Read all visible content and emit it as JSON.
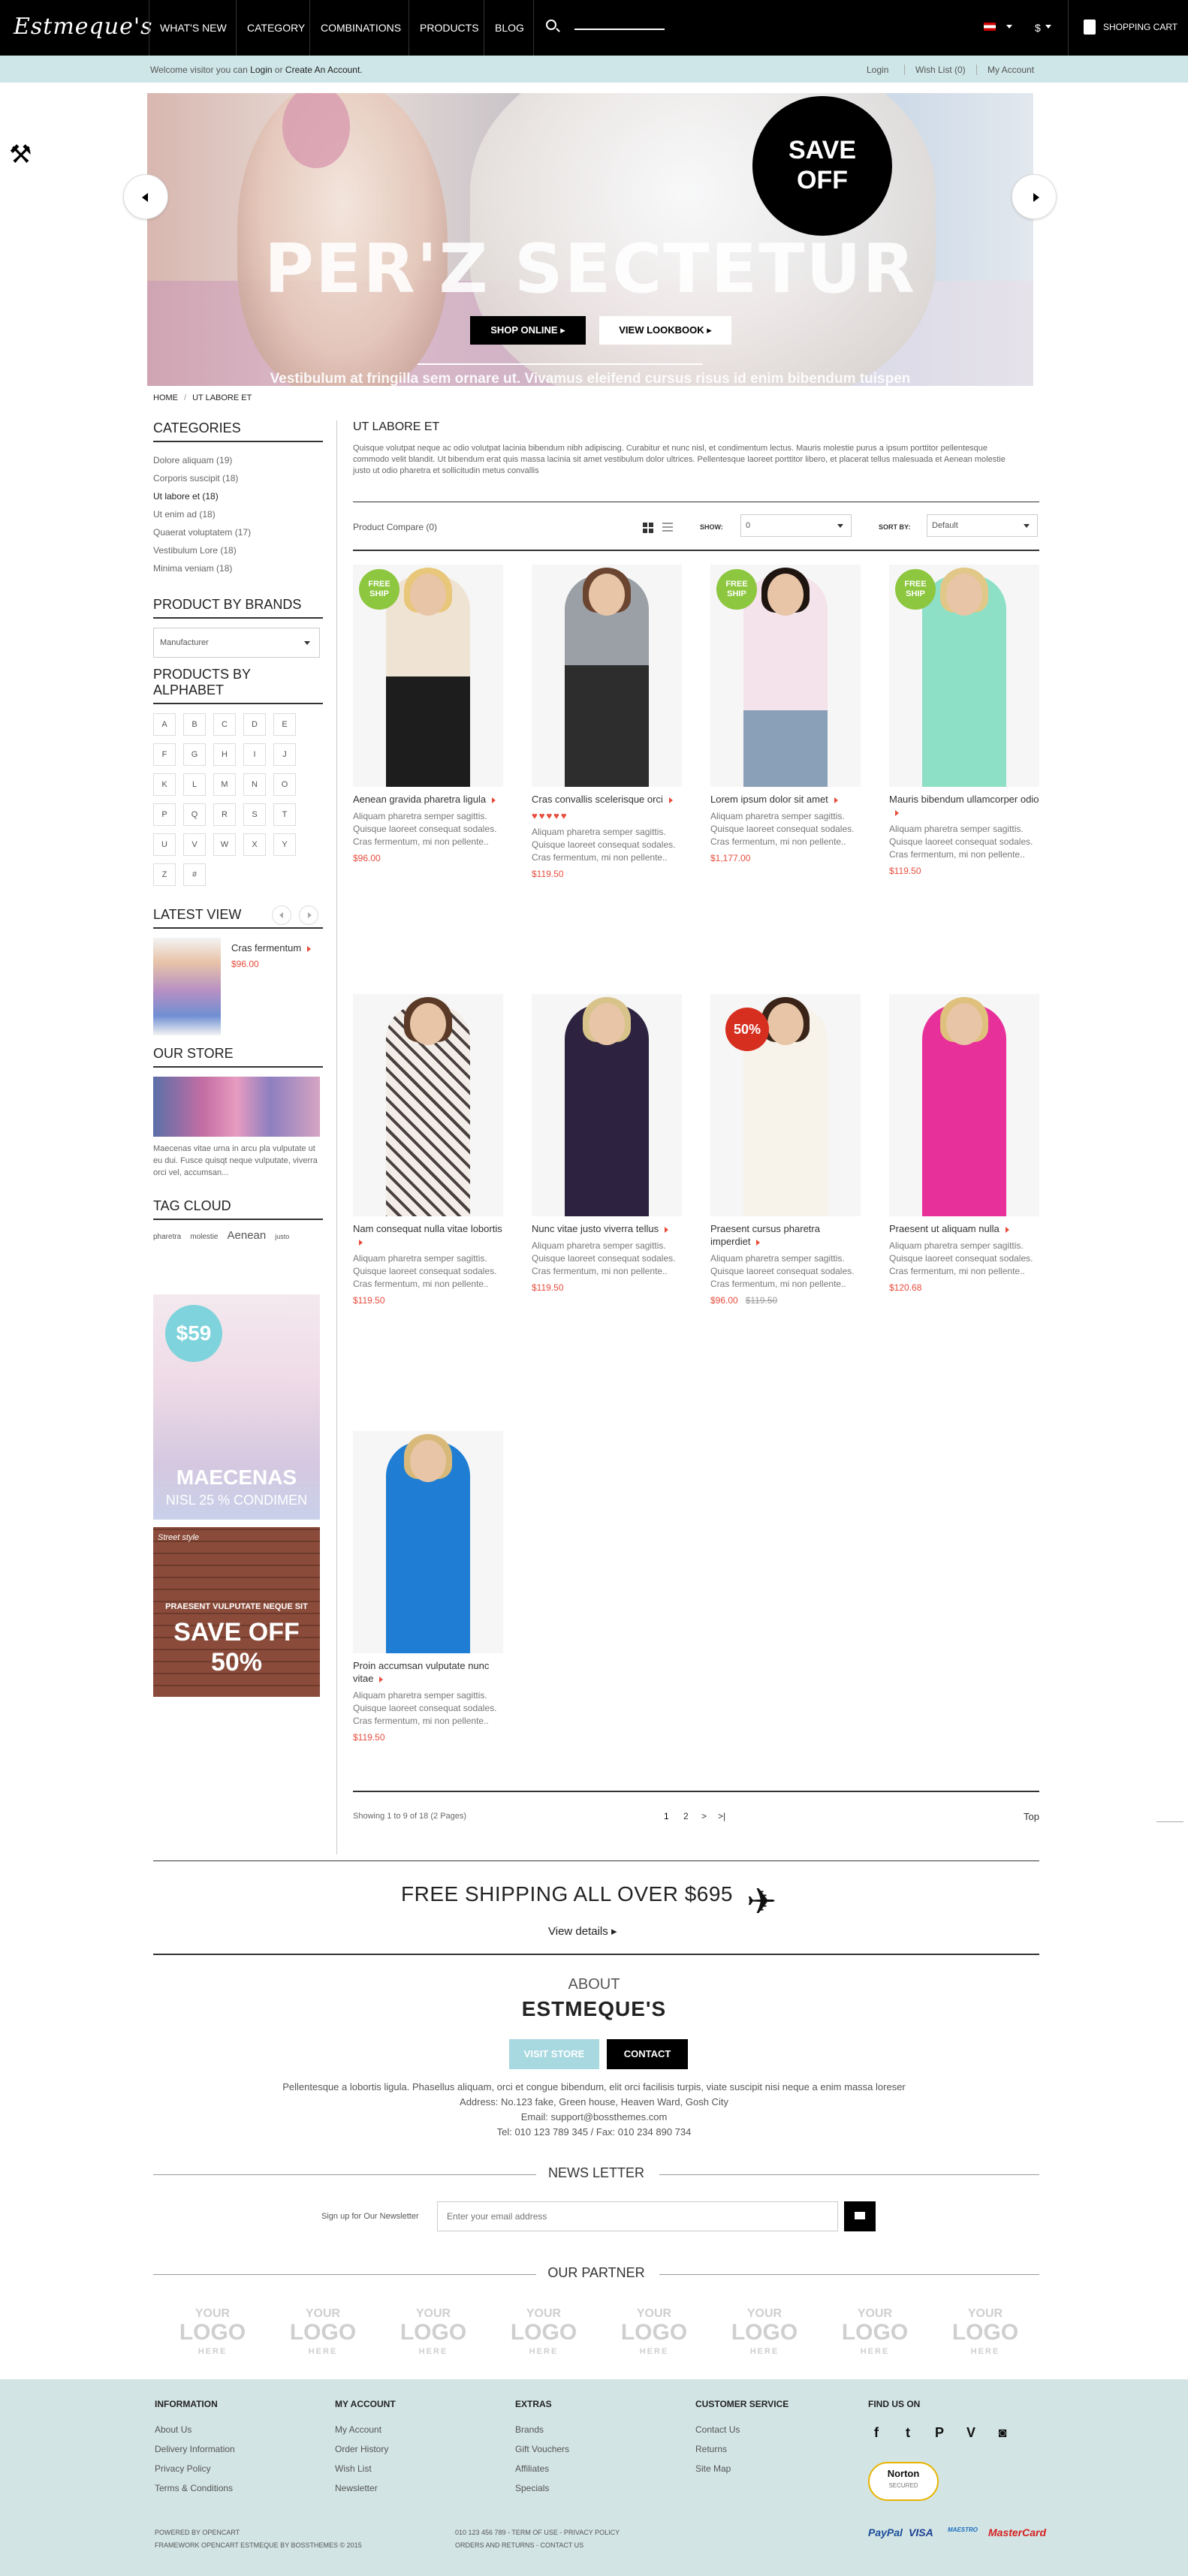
{
  "nav": {
    "logo": "Estmeque's",
    "items": [
      "WHAT'S NEW",
      "CATEGORY",
      "COMBINATIONS",
      "PRODUCTS",
      "BLOG"
    ],
    "currency": "$",
    "cart": "SHOPPING CART"
  },
  "utility": {
    "welcome_pre": "Welcome visitor you can",
    "login": "Login",
    "or": "or",
    "create": "Create An Account.",
    "links": [
      "Login",
      "Wish List (0)",
      "My Account"
    ]
  },
  "hero": {
    "title": "PER'Z SECTETUR",
    "badge_line1": "SAVE",
    "badge_line2": "OFF",
    "shop_btn": "SHOP ONLINE",
    "look_btn": "VIEW LOOKBOOK",
    "subtitle": "Vestibulum at fringilla sem ornare ut. Vivamus eleifend cursus risus id enim bibendum tuispen"
  },
  "breadcrumb": [
    "HOME",
    "UT LABORE ET"
  ],
  "sidebar": {
    "categories_title": "CATEGORIES",
    "categories": [
      "Dolore aliquam (19)",
      "Corporis suscipit (18)",
      "Ut labore et (18)",
      "Ut enim ad (18)",
      "Quaerat voluptatem (17)",
      "Vestibulum Lore (18)",
      "Minima veniam (18)"
    ],
    "brands_title": "PRODUCT BY BRANDS",
    "brand_select": "Manufacturer",
    "alphabet_title": "PRODUCTS BY ALPHABET",
    "alphabet": [
      "A",
      "B",
      "C",
      "D",
      "E",
      "F",
      "G",
      "H",
      "I",
      "J",
      "K",
      "L",
      "M",
      "N",
      "O",
      "P",
      "Q",
      "R",
      "S",
      "T",
      "U",
      "V",
      "W",
      "X",
      "Y",
      "Z",
      "#"
    ],
    "latest_title": "LATEST VIEW",
    "latest_name": "Cras fermentum",
    "latest_price": "$96.00",
    "store_title": "OUR STORE",
    "store_text": "Maecenas vitae urna in arcu pla vulputate ut eu dui. Fusce quisqt neque vulputate, viverra orci vel, accumsan...",
    "tag_title": "TAG CLOUD",
    "tags": [
      "pharetra",
      "molestie",
      "Aenean",
      "justo"
    ],
    "ad1_price": "$59",
    "ad1_title": "MAECENAS",
    "ad1_sub": "NISL 25 % CONDIMEN",
    "ad2_script": "Street style",
    "ad2_small": "PRAESENT VULPUTATE NEQUE SIT",
    "ad2_big1": "SAVE OFF",
    "ad2_big2": "50%"
  },
  "category": {
    "title": "UT LABORE ET",
    "description": "Quisque volutpat neque ac odio volutpat lacinia bibendum nibh adipiscing. Curabitur et nunc nisl, et condimentum lectus. Mauris molestie purus a ipsum porttitor pellentesque commodo velit blandit. Ut bibendum erat quis massa lacinia sit amet vestibulum dolor ultrices. Pellentesque laoreet porttitor libero, et placerat tellus malesuada et Aenean molestie justo ut odio pharetra et sollicitudin metus convallis"
  },
  "toolbar": {
    "compare": "Product Compare (0)",
    "show_label": "SHOW:",
    "show_value": "0",
    "sort_label": "SORT BY:",
    "sort_value": "Default"
  },
  "product_desc": "Aliquam pharetra semper sagittis. Quisque laoreet consequat sodales. Cras fermentum, mi non pellente..",
  "free_badge": "FREE SHIP",
  "products": [
    {
      "name": "Aenean gravida pharetra ligula",
      "price": "$96.00",
      "old_price": "",
      "badge": "free",
      "stars": ""
    },
    {
      "name": "Cras convallis scelerisque orci",
      "price": "$119.50",
      "old_price": "",
      "badge": "",
      "stars": "♥♥♥♥♥"
    },
    {
      "name": "Lorem ipsum dolor sit amet",
      "price": "$1,177.00",
      "old_price": "",
      "badge": "free",
      "stars": ""
    },
    {
      "name": "Mauris bibendum ullamcorper odio",
      "price": "$119.50",
      "old_price": "",
      "badge": "free",
      "stars": ""
    },
    {
      "name": "Nam consequat nulla vitae lobortis",
      "price": "$119.50",
      "old_price": "",
      "badge": "",
      "stars": ""
    },
    {
      "name": "Nunc vitae justo viverra tellus",
      "price": "$119.50",
      "old_price": "",
      "badge": "",
      "stars": ""
    },
    {
      "name": "Praesent cursus pharetra imperdiet",
      "price": "$96.00",
      "old_price": "$119.50",
      "badge": "sale",
      "stars": ""
    },
    {
      "name": "Praesent ut aliquam nulla",
      "price": "$120.68",
      "old_price": "",
      "badge": "",
      "stars": ""
    },
    {
      "name": "Proin accumsan vulputate nunc vitae",
      "price": "$119.50",
      "old_price": "",
      "badge": "",
      "stars": ""
    }
  ],
  "sale_badge": "50%",
  "pagination": {
    "showing": "Showing 1 to 9 of 18 (2 Pages)",
    "pages": [
      "1",
      "2",
      ">",
      ">|"
    ],
    "top": "Top"
  },
  "shipping": {
    "title": "FREE SHIPPING ALL OVER $695",
    "link": "View details"
  },
  "about": {
    "small": "ABOUT",
    "big": "ESTMEQUE'S",
    "visit": "VISIT STORE",
    "contact": "CONTACT",
    "text": "Pellentesque a lobortis ligula. Phasellus aliquam, orci et congue bibendum, elit orci facilisis turpis, viate suscipit nisi neque a enim massa loreser",
    "address": "Address: No.123 fake, Green house, Heaven Ward, Gosh City",
    "email": "Email: support@bossthemes.com",
    "tel": "Tel: 010 123 789 345 / Fax: 010 234 890 734"
  },
  "newsletter": {
    "title": "NEWS LETTER",
    "label": "Sign up for Our Newsletter",
    "placeholder": "Enter your email address"
  },
  "partner": {
    "title": "OUR PARTNER",
    "logo_top": "YOUR",
    "logo_mid": "LOGO",
    "logo_bot": "HERE"
  },
  "footer": {
    "info_title": "INFORMATION",
    "info": [
      "About Us",
      "Delivery Information",
      "Privacy Policy",
      "Terms & Conditions"
    ],
    "account_title": "MY ACCOUNT",
    "account": [
      "My Account",
      "Order History",
      "Wish List",
      "Newsletter"
    ],
    "extras_title": "EXTRAS",
    "extras": [
      "Brands",
      "Gift Vouchers",
      "Affiliates",
      "Specials"
    ],
    "service_title": "CUSTOMER SERVICE",
    "service": [
      "Contact Us",
      "Returns",
      "Site Map"
    ],
    "find_title": "FIND US ON",
    "norton": "Norton",
    "norton_sub": "SECURED",
    "copy1": "POWERED BY OPENCART",
    "copy2": "FRAMEWORK OPENCART ESTMEQUE BY BOSSTHEMES © 2015",
    "contact1": "010 123 456 789 - TERM OF USE - PRIVACY POLICY",
    "contact2": "ORDERS AND RETURNS - CONTACT US",
    "payments": [
      "PayPal",
      "VISA",
      "MAESTRO",
      "MasterCard"
    ]
  },
  "colors": {
    "accent_red": "#e74c3c",
    "util_bar": "#cfe6e8",
    "footer_bg": "#d3e4e4",
    "free_badge": "#8dc63f",
    "visit_btn": "#a8d8e0"
  }
}
